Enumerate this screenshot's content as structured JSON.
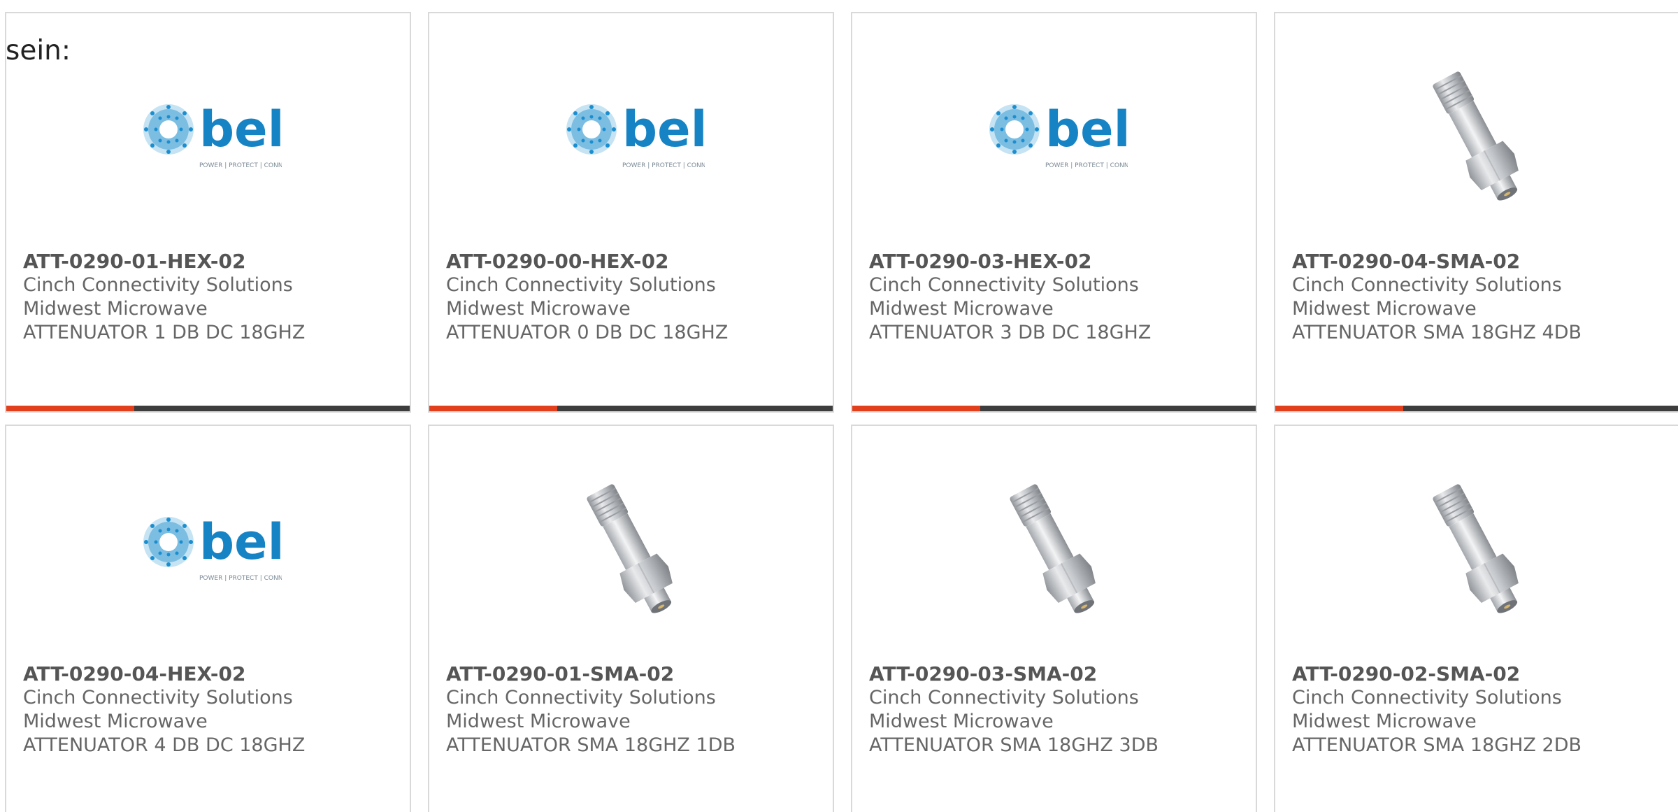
{
  "intro_text": "sein:",
  "colors": {
    "accent": "#e2401c",
    "bar_dark": "#3d3d3d",
    "bel_blue": "#1683c5",
    "bel_light": "#5aaedb"
  },
  "logo": {
    "name": "bel",
    "tagline": "POWER | PROTECT | CONNECT"
  },
  "products": [
    {
      "part": "ATT-0290-01-HEX-02",
      "manufacturer": "Cinch Connectivity Solutions",
      "brand": "Midwest Microwave",
      "description": "ATTENUATOR 1 DB DC 18GHZ",
      "image": "bel-logo",
      "show_bar": true
    },
    {
      "part": "ATT-0290-00-HEX-02",
      "manufacturer": "Cinch Connectivity Solutions",
      "brand": "Midwest Microwave",
      "description": "ATTENUATOR 0 DB DC 18GHZ",
      "image": "bel-logo",
      "show_bar": true
    },
    {
      "part": "ATT-0290-03-HEX-02",
      "manufacturer": "Cinch Connectivity Solutions",
      "brand": "Midwest Microwave",
      "description": "ATTENUATOR 3 DB DC 18GHZ",
      "image": "bel-logo",
      "show_bar": true
    },
    {
      "part": "ATT-0290-04-SMA-02",
      "manufacturer": "Cinch Connectivity Solutions",
      "brand": "Midwest Microwave",
      "description": "ATTENUATOR SMA 18GHZ 4DB",
      "image": "sma-attenuator-photo",
      "show_bar": true
    },
    {
      "part": "ATT-0290-04-HEX-02",
      "manufacturer": "Cinch Connectivity Solutions",
      "brand": "Midwest Microwave",
      "description": "ATTENUATOR 4 DB DC 18GHZ",
      "image": "bel-logo",
      "show_bar": false
    },
    {
      "part": "ATT-0290-01-SMA-02",
      "manufacturer": "Cinch Connectivity Solutions",
      "brand": "Midwest Microwave",
      "description": "ATTENUATOR SMA 18GHZ 1DB",
      "image": "sma-attenuator-photo",
      "show_bar": false
    },
    {
      "part": "ATT-0290-03-SMA-02",
      "manufacturer": "Cinch Connectivity Solutions",
      "brand": "Midwest Microwave",
      "description": "ATTENUATOR SMA 18GHZ 3DB",
      "image": "sma-attenuator-photo",
      "show_bar": false
    },
    {
      "part": "ATT-0290-02-SMA-02",
      "manufacturer": "Cinch Connectivity Solutions",
      "brand": "Midwest Microwave",
      "description": "ATTENUATOR SMA 18GHZ 2DB",
      "image": "sma-attenuator-photo",
      "show_bar": false
    }
  ]
}
